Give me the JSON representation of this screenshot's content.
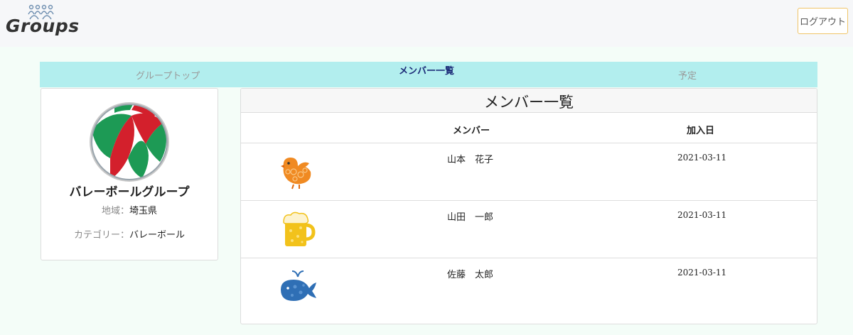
{
  "header": {
    "logo_text": "Groups",
    "logout_label": "ログアウト"
  },
  "tabs": [
    {
      "label": "グループトップ",
      "active": false
    },
    {
      "label": "メンバー一覧",
      "active": true
    },
    {
      "label": "予定",
      "active": false
    }
  ],
  "group": {
    "name": "バレーボールグループ",
    "region_label": "地域：",
    "region_value": "埼玉県",
    "category_label": "カテゴリー：",
    "category_value": "バレーボール"
  },
  "members_panel": {
    "title": "メンバー一覧",
    "col_member": "メンバー",
    "col_joined": "加入日",
    "rows": [
      {
        "name": "山本　花子",
        "joined": "2021-03-11",
        "avatar": "bird-icon"
      },
      {
        "name": "山田　一郎",
        "joined": "2021-03-11",
        "avatar": "beer-icon"
      },
      {
        "name": "佐藤　太郎",
        "joined": "2021-03-11",
        "avatar": "whale-icon"
      }
    ]
  },
  "colors": {
    "tab_bar": "#b2eeee",
    "active_tab_text": "#1c2b78",
    "logout_border": "#f0c468",
    "page_bg": "#f4fdf8"
  }
}
